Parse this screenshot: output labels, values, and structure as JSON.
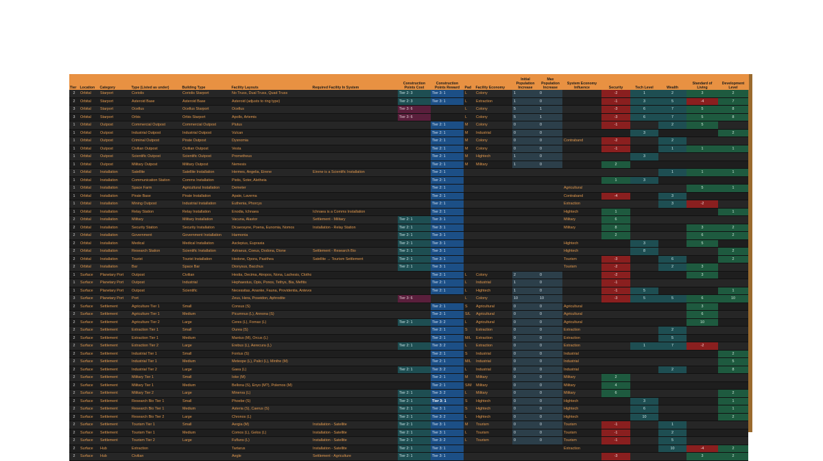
{
  "columns": [
    "Tier",
    "Location",
    "Category",
    "Type (Listed as under)",
    "Building Type",
    "Facility Layouts",
    "Required Facility In System",
    "Construction Points Cost",
    "Construction Points Reward",
    "Pad",
    "Facility Economy",
    "Initial Population Increase",
    "Max Population Increase",
    "System Economy Influence",
    "Security",
    "Tech Level",
    "Wealth",
    "Standard of Living",
    "Development Level"
  ],
  "rows": [
    [
      "2",
      "Orbital",
      "Starport",
      "Coriolis",
      "Coriolis Starport",
      "No Truss, Dual Truss, Quad Truss",
      "",
      "Tier 2: 3",
      "Tier 3: 1",
      "L",
      "Colony",
      "1",
      "0",
      "",
      "-2",
      "1",
      "2",
      "3",
      "2"
    ],
    [
      "2",
      "Orbital",
      "Starport",
      "Asteroid Base",
      "Asteroid Base",
      "Asteroid (adjusts to ring type)",
      "",
      "Tier 2: 3",
      "Tier 3: 1",
      "L",
      "Extraction",
      "1",
      "0",
      "",
      "-1",
      "3",
      "5",
      "-4",
      "7"
    ],
    [
      "3",
      "Orbital",
      "Starport",
      "Ocellus",
      "Ocellus Starport",
      "Ocellus",
      "",
      "Tier 3: 6",
      "",
      "L",
      "Colony",
      "5",
      "1",
      "",
      "-3",
      "6",
      "7",
      "5",
      "8"
    ],
    [
      "3",
      "Orbital",
      "Starport",
      "Orbis",
      "Orbis Starport",
      "Apollo, Artemis",
      "",
      "Tier 3: 6",
      "",
      "L",
      "Colony",
      "5",
      "1",
      "",
      "-3",
      "6",
      "7",
      "5",
      "8"
    ],
    [
      "1",
      "Orbital",
      "Outpost",
      "Commercial Outpost",
      "Commercial Outpost",
      "Plutus",
      "",
      "",
      "Tier 2: 1",
      "M",
      "Colony",
      "0",
      "0",
      "",
      "-1",
      "",
      "2",
      "5",
      ""
    ],
    [
      "1",
      "Orbital",
      "Outpost",
      "Industrial Outpost",
      "Industrial Outpost",
      "Vulcan",
      "",
      "",
      "Tier 2: 1",
      "M",
      "Industrial",
      "0",
      "0",
      "",
      "",
      "3",
      "",
      "",
      "2"
    ],
    [
      "1",
      "Orbital",
      "Outpost",
      "Criminal Outpost",
      "Pirate Outpost",
      "Dysnomia",
      "",
      "",
      "Tier 2: 1",
      "M",
      "Colony",
      "0",
      "0",
      "Contraband",
      "-2",
      "",
      "2",
      "",
      ""
    ],
    [
      "1",
      "Orbital",
      "Outpost",
      "Civilian Outpost",
      "Civilian Outpost",
      "Vesta",
      "",
      "",
      "Tier 2: 1",
      "M",
      "Colony",
      "0",
      "0",
      "",
      "-1",
      "",
      "1",
      "1",
      "1"
    ],
    [
      "1",
      "Orbital",
      "Outpost",
      "Scientific Outpost",
      "Scientific Outpost",
      "Prometheus",
      "",
      "",
      "Tier 2: 1",
      "M",
      "Hightech",
      "1",
      "0",
      "",
      "",
      "3",
      "",
      "",
      ""
    ],
    [
      "1",
      "Orbital",
      "Outpost",
      "Military Outpost",
      "Military Outpost",
      "Nemesis",
      "",
      "",
      "Tier 2: 1",
      "M",
      "Military",
      "1",
      "0",
      "",
      "2",
      "",
      "",
      "",
      ""
    ],
    [
      "1",
      "Orbital",
      "Installation",
      "Satellite",
      "Satellite Installation",
      "Hermes, Angelia, Eirene",
      "Eirene is a Scientific Installation",
      "",
      "Tier 2: 1",
      "",
      "",
      "",
      "",
      "",
      "",
      "",
      "1",
      "1",
      "1"
    ],
    [
      "1",
      "Orbital",
      "Installation",
      "Communication Station",
      "Comms Installation",
      "Pistis, Soter, Aletheia",
      "",
      "",
      "Tier 2: 1",
      "",
      "",
      "",
      "",
      "",
      "1",
      "3",
      "",
      "",
      ""
    ],
    [
      "1",
      "Orbital",
      "Installation",
      "Space Farm",
      "Agricultural Installation",
      "Demeter",
      "",
      "",
      "Tier 2: 1",
      "",
      "",
      "",
      "",
      "Agricultural",
      "",
      "",
      "",
      "5",
      "1"
    ],
    [
      "1",
      "Orbital",
      "Installation",
      "Pirate Base",
      "Pirate Installation",
      "Apate, Laverna",
      "",
      "",
      "Tier 2: 1",
      "",
      "",
      "",
      "",
      "Contraband",
      "-4",
      "",
      "3",
      "",
      ""
    ],
    [
      "1",
      "Orbital",
      "Installation",
      "Mining Outpost",
      "Industrial Installation",
      "Euthenia, Phorcys",
      "",
      "",
      "Tier 2: 1",
      "",
      "",
      "",
      "",
      "Extraction",
      "",
      "",
      "3",
      "-2",
      ""
    ],
    [
      "1",
      "Orbital",
      "Installation",
      "Relay Station",
      "Relay Installation",
      "Enodia, Ichnaea",
      "Ichnaea is a Comms Installation",
      "",
      "Tier 2: 1",
      "",
      "",
      "",
      "",
      "Hightech",
      "1",
      "",
      "",
      "",
      "1"
    ],
    [
      "2",
      "Orbital",
      "Installation",
      "Military",
      "Military Installation",
      "Vacuna, Alastor",
      "Settlement - Military",
      "Tier 2: 1",
      "Tier 3: 1",
      "",
      "",
      "",
      "",
      "Military",
      "6",
      "",
      "",
      "",
      ""
    ],
    [
      "2",
      "Orbital",
      "Installation",
      "Security Station",
      "Security Installation",
      "Dicaeosyne, Poena, Eunomia, Nomos",
      "Installation - Relay Station",
      "Tier 2: 1",
      "Tier 3: 1",
      "",
      "",
      "",
      "",
      "Military",
      "8",
      "",
      "",
      "3",
      "2"
    ],
    [
      "2",
      "Orbital",
      "Installation",
      "Government",
      "Government Installation",
      "Harmonia",
      "",
      "Tier 2: 1",
      "Tier 3: 1",
      "",
      "",
      "",
      "",
      "",
      "2",
      "",
      "",
      "6",
      "2"
    ],
    [
      "2",
      "Orbital",
      "Installation",
      "Medical",
      "Medical Installation",
      "Asclepius, Eupraxia",
      "",
      "Tier 2: 1",
      "Tier 3: 1",
      "",
      "",
      "",
      "",
      "Hightech",
      "",
      "3",
      "",
      "5",
      ""
    ],
    [
      "2",
      "Orbital",
      "Installation",
      "Research Station",
      "Scientific Installation",
      "Astraeus, Coeus, Dodona, Dione",
      "Settlement - Research Bio",
      "Tier 2: 1",
      "Tier 3: 1",
      "",
      "",
      "",
      "",
      "Hightech",
      "",
      "8",
      "",
      "",
      "2"
    ],
    [
      "2",
      "Orbital",
      "Installation",
      "Tourist",
      "Tourist Installation",
      "Hedone, Opora, Pasithea",
      "Satellite → Tourism Settlement",
      "Tier 2: 1",
      "Tier 3: 1",
      "",
      "",
      "",
      "",
      "Tourism",
      "-3",
      "",
      "6",
      "",
      "2"
    ],
    [
      "2",
      "Orbital",
      "Installation",
      "Bar",
      "Space Bar",
      "Dionysus, Bacchus",
      "",
      "Tier 2: 1",
      "Tier 3: 1",
      "",
      "",
      "",
      "",
      "Tourism",
      "-2",
      "",
      "2",
      "3",
      ""
    ],
    [
      "1",
      "Surface",
      "Planetary Port",
      "Outpost",
      "Civilian",
      "Hestia, Decima, Atropos, Nona, Lachesis, Clotho",
      "",
      "",
      "Tier 2: 1",
      "L",
      "Colony",
      "2",
      "0",
      "",
      "-2",
      "",
      "",
      "3",
      ""
    ],
    [
      "1",
      "Surface",
      "Planetary Port",
      "Outpost",
      "Industrial",
      "Hephaestus, Opis, Ponos, Tethys, Bia, Mefitis",
      "",
      "",
      "Tier 2: 1",
      "L",
      "Industrial",
      "1",
      "0",
      "",
      "-1",
      "",
      "",
      "",
      ""
    ],
    [
      "1",
      "Surface",
      "Planetary Port",
      "Outpost",
      "Scientific",
      "Necessitas, Ananke, Fauna, Providentia, Antevorta, Porrima",
      "",
      "",
      "Tier 2: 1",
      "L",
      "Hightech",
      "1",
      "0",
      "",
      "-1",
      "5",
      "",
      "",
      "1"
    ],
    [
      "3",
      "Surface",
      "Planetary Port",
      "Port",
      "",
      "Zeus, Hera, Poseidon, Aphrodite",
      "",
      "Tier 3: 6",
      "",
      "L",
      "Colony",
      "10",
      "10",
      "",
      "-3",
      "5",
      "5",
      "6",
      "10"
    ],
    [
      "2",
      "Surface",
      "Settlement",
      "Agriculture Tier 1",
      "Small",
      "Consus (S)",
      "",
      "",
      "Tier 2: 1",
      "S",
      "Agricultural",
      "0",
      "0",
      "Agricultural",
      "",
      "",
      "",
      "3",
      ""
    ],
    [
      "2",
      "Surface",
      "Settlement",
      "Agriculture Tier 1",
      "Medium",
      "Picumnus (L), Annona (S)",
      "",
      "",
      "Tier 2: 1",
      "S/L",
      "Agricultural",
      "0",
      "0",
      "Agricultural",
      "",
      "",
      "",
      "6",
      ""
    ],
    [
      "2",
      "Surface",
      "Settlement",
      "Agriculture Tier 2",
      "Large",
      "Ceres (L), Fornax (L)",
      "",
      "Tier 2: 1",
      "Tier 3: 2",
      "L",
      "Agricultural",
      "0",
      "0",
      "Agricultural",
      "",
      "",
      "",
      "10",
      ""
    ],
    [
      "2",
      "Surface",
      "Settlement",
      "Extraction Tier 1",
      "Small",
      "Ourea (S)",
      "",
      "",
      "Tier 2: 1",
      "S",
      "Extraction",
      "0",
      "0",
      "Extraction",
      "",
      "",
      "2",
      "",
      ""
    ],
    [
      "2",
      "Surface",
      "Settlement",
      "Extraction Tier 1",
      "Medium",
      "Mantus (M), Orcus (L)",
      "",
      "",
      "Tier 2: 1",
      "M/L",
      "Extraction",
      "0",
      "0",
      "Extraction",
      "",
      "",
      "5",
      "",
      ""
    ],
    [
      "2",
      "Surface",
      "Settlement",
      "Extraction Tier 2",
      "Large",
      "Erebus (L), Aerecura (L)",
      "",
      "Tier 2: 1",
      "Tier 3: 2",
      "L",
      "Extraction",
      "0",
      "0",
      "Extraction",
      "",
      "1",
      "7",
      "-2",
      ""
    ],
    [
      "2",
      "Surface",
      "Settlement",
      "Industrial Tier 1",
      "Small",
      "Fontus (S)",
      "",
      "",
      "Tier 2: 1",
      "S",
      "Industrial",
      "0",
      "0",
      "Industrial",
      "",
      "",
      "",
      "",
      "2"
    ],
    [
      "2",
      "Surface",
      "Settlement",
      "Industrial Tier 1",
      "Medium",
      "Meteope (L), Palici (L), Minthe (M)",
      "",
      "",
      "Tier 2: 1",
      "M/L",
      "Industrial",
      "0",
      "0",
      "Industrial",
      "",
      "",
      "",
      "",
      "5"
    ],
    [
      "2",
      "Surface",
      "Settlement",
      "Industrial Tier 2",
      "Large",
      "Gaea (L)",
      "",
      "Tier 2: 1",
      "Tier 3: 2",
      "L",
      "Industrial",
      "0",
      "0",
      "Industrial",
      "",
      "",
      "2",
      "",
      "8"
    ],
    [
      "2",
      "Surface",
      "Settlement",
      "Military Tier 1",
      "Small",
      "Ioke (M)",
      "",
      "",
      "Tier 2: 1",
      "M",
      "Military",
      "0",
      "0",
      "Military",
      "2",
      "",
      "",
      "",
      ""
    ],
    [
      "2",
      "Surface",
      "Settlement",
      "Military Tier 1",
      "Medium",
      "Bellona (S), Enyo (M?), Polemos (M)",
      "",
      "",
      "Tier 2: 1",
      "S/M",
      "Military",
      "0",
      "0",
      "Military",
      "4",
      "",
      "",
      "",
      ""
    ],
    [
      "2",
      "Surface",
      "Settlement",
      "Military Tier 2",
      "Large",
      "Minerva (L)",
      "",
      "Tier 2: 1",
      "Tier 3: 2",
      "L",
      "Military",
      "0",
      "0",
      "Military",
      "6",
      "",
      "",
      "",
      "2"
    ],
    [
      "2",
      "Surface",
      "Settlement",
      "Research Bio Tier 1",
      "Small",
      "Phoebe (S)",
      "",
      "Tier 2: 1",
      "Tier 3: 1",
      "S",
      "Hightech",
      "0",
      "0",
      "Hightech",
      "",
      "3",
      "",
      "",
      "1"
    ],
    [
      "2",
      "Surface",
      "Settlement",
      "Research Bio Tier 1",
      "Medium",
      "Asteria (S), Caerus (S)",
      "",
      "Tier 2: 1",
      "Tier 3: 1",
      "S",
      "Hightech",
      "0",
      "0",
      "Hightech",
      "",
      "6",
      "",
      "",
      "1"
    ],
    [
      "2",
      "Surface",
      "Settlement",
      "Research Bio Tier 2",
      "Large",
      "Chronos (L)",
      "",
      "Tier 2: 1",
      "Tier 3: 2",
      "L",
      "Hightech",
      "0",
      "0",
      "Hightech",
      "",
      "10",
      "",
      "",
      "2"
    ],
    [
      "2",
      "Surface",
      "Settlement",
      "Tourism Tier 1",
      "Small",
      "Aergia (M)",
      "Installation - Satellite",
      "Tier 2: 1",
      "Tier 3: 1",
      "M",
      "Tourism",
      "0",
      "0",
      "Tourism",
      "-1",
      "",
      "1",
      "",
      ""
    ],
    [
      "2",
      "Surface",
      "Settlement",
      "Tourism Tier 1",
      "Medium",
      "Comos (L), Gelos (L)",
      "Installation - Satellite",
      "Tier 2: 1",
      "Tier 3: 1",
      "L",
      "Tourism",
      "0",
      "0",
      "Tourism",
      "-1",
      "",
      "2",
      "",
      ""
    ],
    [
      "2",
      "Surface",
      "Settlement",
      "Tourism Tier 2",
      "Large",
      "Fufluns (L)",
      "Installation - Satellite",
      "Tier 2: 1",
      "Tier 3: 2",
      "L",
      "Tourism",
      "0",
      "0",
      "Tourism",
      "-1",
      "",
      "5",
      "",
      ""
    ],
    [
      "2",
      "Surface",
      "Hub",
      "Extraction",
      "",
      "Tartarus",
      "Installation - Satellite",
      "Tier 2: 1",
      "Tier 3: 1",
      "",
      "",
      "",
      "",
      "Extraction",
      "",
      "",
      "10",
      "-4",
      "2"
    ],
    [
      "2",
      "Surface",
      "Hub",
      "Civilian",
      "",
      "Aegle",
      "Settlement - Agriculture",
      "Tier 2: 1",
      "Tier 3: 1",
      "",
      "",
      "",
      "",
      "",
      "-3",
      "",
      "",
      "3",
      "2"
    ]
  ],
  "colors": {
    "header_bg": "#e89142",
    "text_orange": "#e49a4e",
    "cost_teal": "#1e4e52",
    "cost_magenta": "#5a1f3c",
    "reward_blue": "#1c4f86",
    "positive_green": "#1e5a3f",
    "negative_red": "#8a1f1f"
  }
}
